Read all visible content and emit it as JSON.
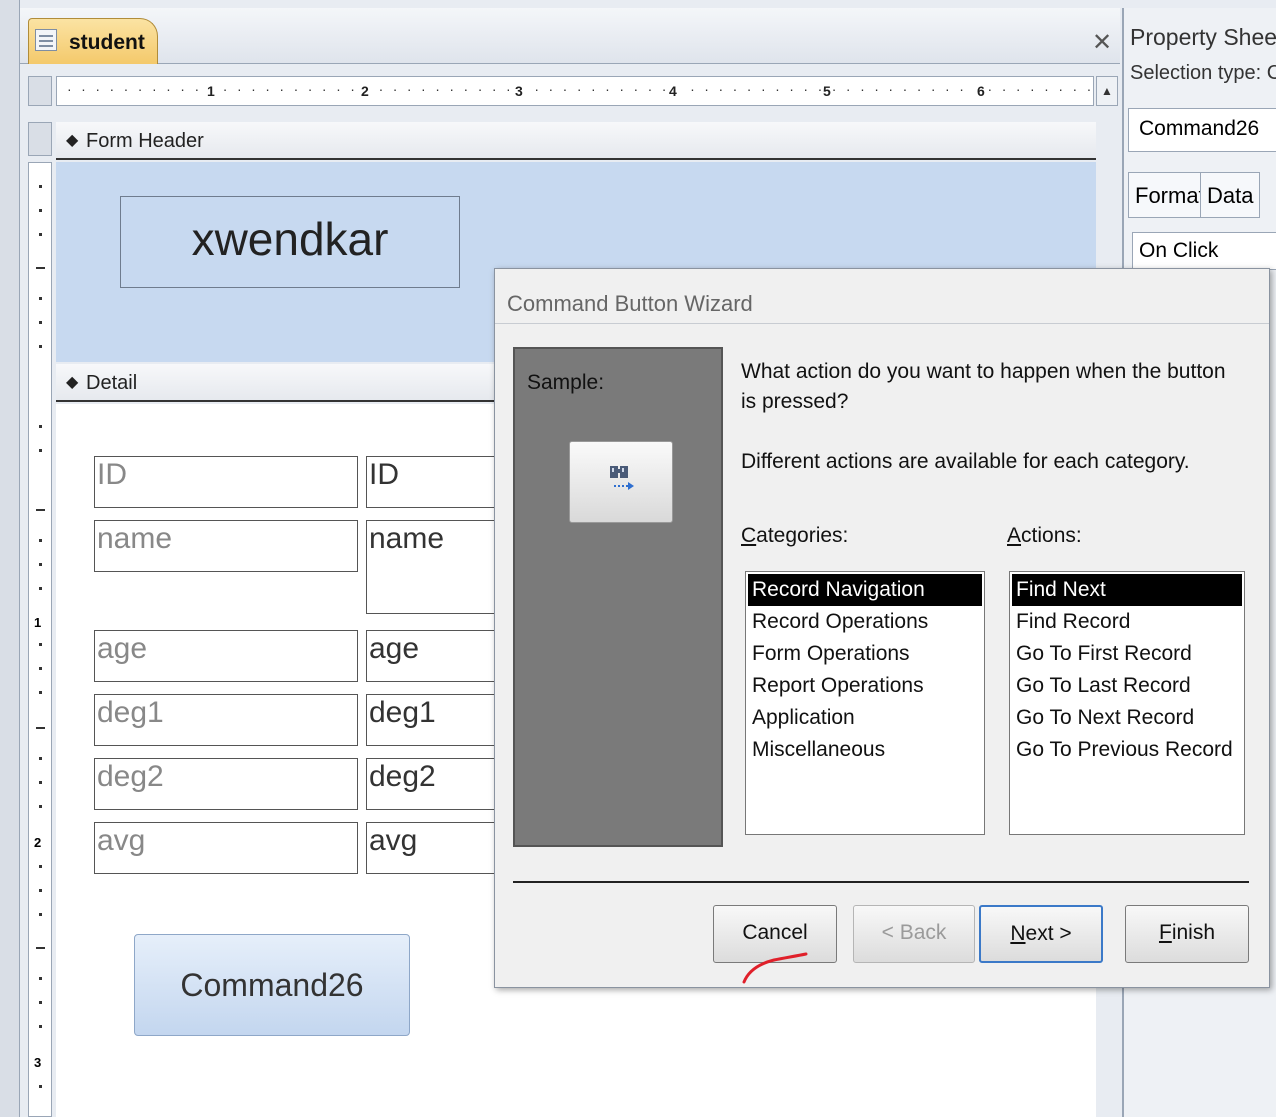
{
  "document_tab": {
    "label": "student"
  },
  "ruler": {
    "numbers": [
      "1",
      "2",
      "3",
      "4",
      "5",
      "6"
    ],
    "vertical_numbers": [
      "1",
      "2",
      "3"
    ]
  },
  "sections": {
    "header_label": "Form Header",
    "detail_label": "Detail"
  },
  "form": {
    "title": "xwendkar",
    "fields": [
      {
        "label": "ID",
        "value": "ID"
      },
      {
        "label": "name",
        "value": "name"
      },
      {
        "label": "age",
        "value": "age"
      },
      {
        "label": "deg1",
        "value": "deg1"
      },
      {
        "label": "deg2",
        "value": "deg2"
      },
      {
        "label": "avg",
        "value": "avg"
      }
    ],
    "command_button": "Command26"
  },
  "property_sheet": {
    "title": "Property Sheet",
    "selection_type": "Selection type:  C",
    "selected_object": "Command26",
    "tabs": [
      "Format",
      "Data"
    ],
    "row_label": "On Click"
  },
  "wizard": {
    "title": "Command Button Wizard",
    "sample_label": "Sample:",
    "question": "What action do you want to happen when the button is pressed?",
    "info": "Different actions are available for each category.",
    "categories_label": "Categories:",
    "actions_label": "Actions:",
    "categories": [
      "Record Navigation",
      "Record Operations",
      "Form Operations",
      "Report Operations",
      "Application",
      "Miscellaneous"
    ],
    "actions": [
      "Find Next",
      "Find Record",
      "Go To First Record",
      "Go To Last Record",
      "Go To Next Record",
      "Go To Previous Record"
    ],
    "selected_category": "Record Navigation",
    "selected_action": "Find Next",
    "buttons": {
      "cancel": "Cancel",
      "back": "< Back",
      "next": "Next >",
      "finish": "Finish"
    }
  },
  "colors": {
    "header_bg": "#c7d9f0",
    "selection": "#000000",
    "annotation": "#e0202a"
  }
}
